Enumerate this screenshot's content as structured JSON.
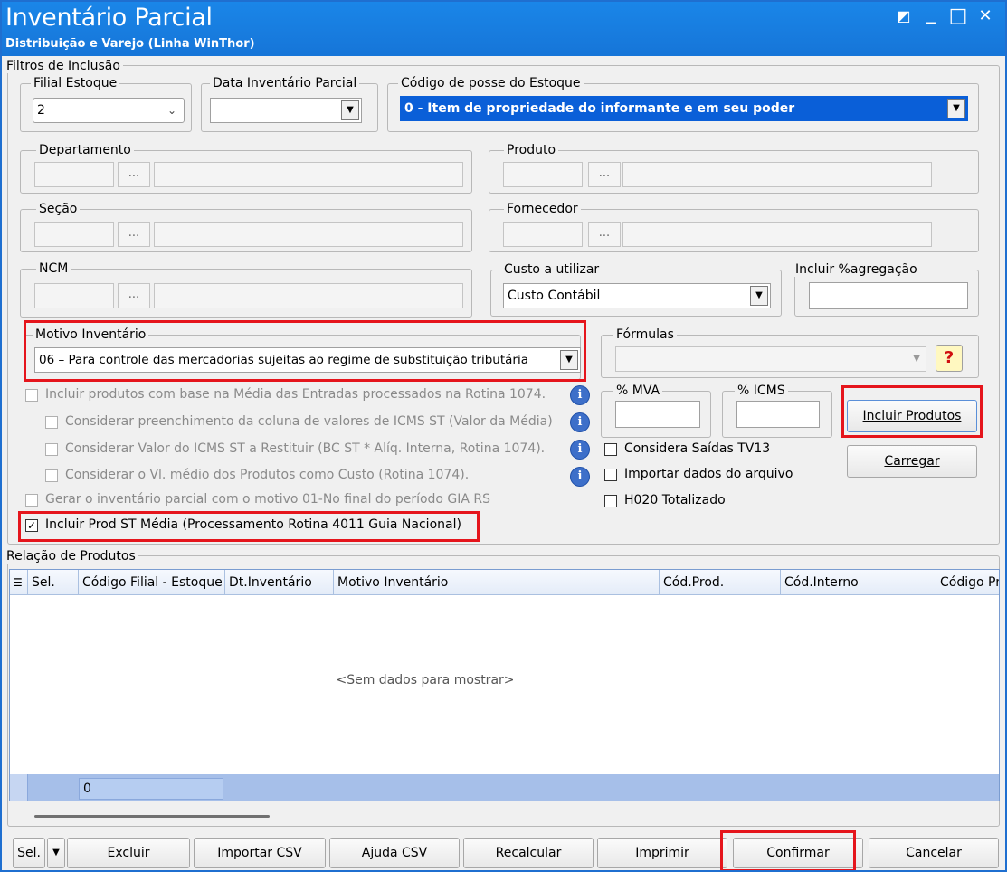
{
  "window": {
    "title": "Inventário Parcial",
    "subtitle": "Distribuição e Varejo (Linha WinThor)",
    "controls": {
      "restore": "◩",
      "minimize": "_",
      "maximize": "□",
      "close": "✕"
    }
  },
  "filters": {
    "group_label": "Filtros de Inclusão",
    "filial": {
      "label": "Filial Estoque",
      "value": "2"
    },
    "data_inventario": {
      "label": "Data Inventário Parcial",
      "value": ""
    },
    "codigo_posse": {
      "label": "Código de posse do Estoque",
      "value": "0 - Item de propriedade do informante e em seu poder"
    },
    "departamento": {
      "label": "Departamento",
      "dots": "..."
    },
    "produto": {
      "label": "Produto",
      "dots": "..."
    },
    "secao": {
      "label": "Seção",
      "dots": "..."
    },
    "fornecedor": {
      "label": "Fornecedor",
      "dots": "..."
    },
    "ncm": {
      "label": "NCM",
      "dots": "..."
    },
    "custo": {
      "label": "Custo a utilizar",
      "value": "Custo Contábil"
    },
    "agregacao": {
      "label": "Incluir %agregação",
      "value": ""
    },
    "motivo": {
      "label": "Motivo Inventário",
      "value": "06 – Para controle das mercadorias sujeitas ao regime de substituição tributária"
    },
    "formulas": {
      "label": "Fórmulas",
      "value": "",
      "help": "?"
    },
    "mva": {
      "label": "% MVA",
      "value": ""
    },
    "icms": {
      "label": "% ICMS",
      "value": ""
    }
  },
  "options": {
    "incluir_media": "Incluir produtos com base na Média das Entradas processados na Rotina 1074.",
    "considerar_icms_st": "Considerar preenchimento da coluna de valores de ICMS ST (Valor da Média)",
    "considerar_valor_restituir": "Considerar Valor do ICMS ST a Restituir (BC ST * Alíq. Interna, Rotina 1074).",
    "considerar_vl_medio": "Considerar o Vl. médio dos Produtos como Custo (Rotina 1074).",
    "gerar_motivo_01": "Gerar o inventário parcial com o motivo 01-No final do período GIA RS",
    "incluir_prod_st": "Incluir Prod ST Média (Processamento Rotina 4011 Guia Nacional)",
    "considera_saidas": "Considera Saídas TV13",
    "importar_dados": "Importar dados do arquivo",
    "h020": "H020 Totalizado",
    "info_icon": "i"
  },
  "buttons": {
    "incluir_produtos": "Incluir Produtos",
    "carregar": "Carregar",
    "sel": "Sel.",
    "excluir": "Excluir",
    "importar_csv": "Importar CSV",
    "ajuda_csv": "Ajuda CSV",
    "recalcular": "Recalcular",
    "imprimir": "Imprimir",
    "confirmar": "Confirmar",
    "cancelar": "Cancelar"
  },
  "grid": {
    "group_label": "Relação de Produtos",
    "columns": [
      "Sel.",
      "Código Filial - Estoque",
      "Dt.Inventário",
      "Motivo Inventário",
      "Cód.Prod.",
      "Cód.Interno",
      "Código Pr"
    ],
    "empty_text": "<Sem dados para mostrar>",
    "footer_value": "0"
  },
  "colors": {
    "titlebar": "#1a86e8",
    "highlight": "#e5151c",
    "selection": "#0a5fd8"
  }
}
